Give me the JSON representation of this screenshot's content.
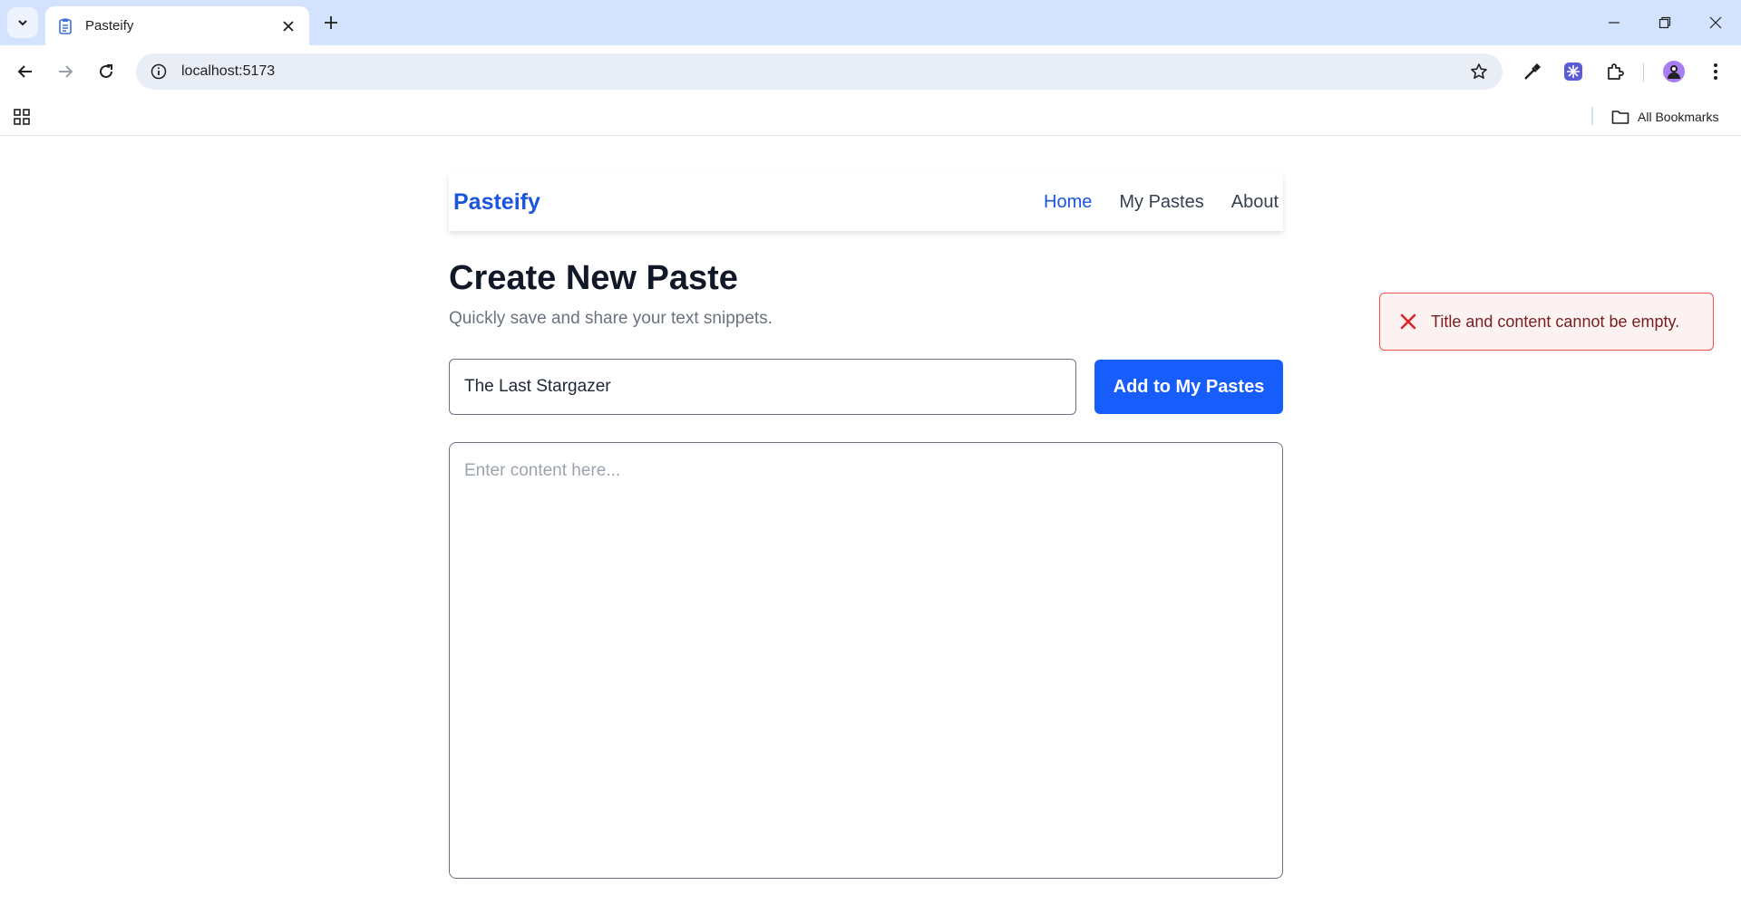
{
  "browser": {
    "tab_title": "Pasteify",
    "url": "localhost:5173",
    "all_bookmarks_label": "All Bookmarks"
  },
  "navbar": {
    "brand": "Pasteify",
    "links": [
      {
        "label": "Home",
        "active": true
      },
      {
        "label": "My Pastes",
        "active": false
      },
      {
        "label": "About",
        "active": false
      }
    ]
  },
  "main": {
    "heading": "Create New Paste",
    "subheading": "Quickly save and share your text snippets.",
    "title_input_value": "The Last Stargazer",
    "add_button_label": "Add to My Pastes",
    "content_placeholder": "Enter content here..."
  },
  "toast": {
    "message": "Title and content cannot be empty.",
    "type": "error"
  },
  "colors": {
    "accent": "#165dfc",
    "brand": "#1a56db",
    "error_bg": "#fdf2f2",
    "error_border": "#f05252",
    "error_icon": "#e02424"
  }
}
